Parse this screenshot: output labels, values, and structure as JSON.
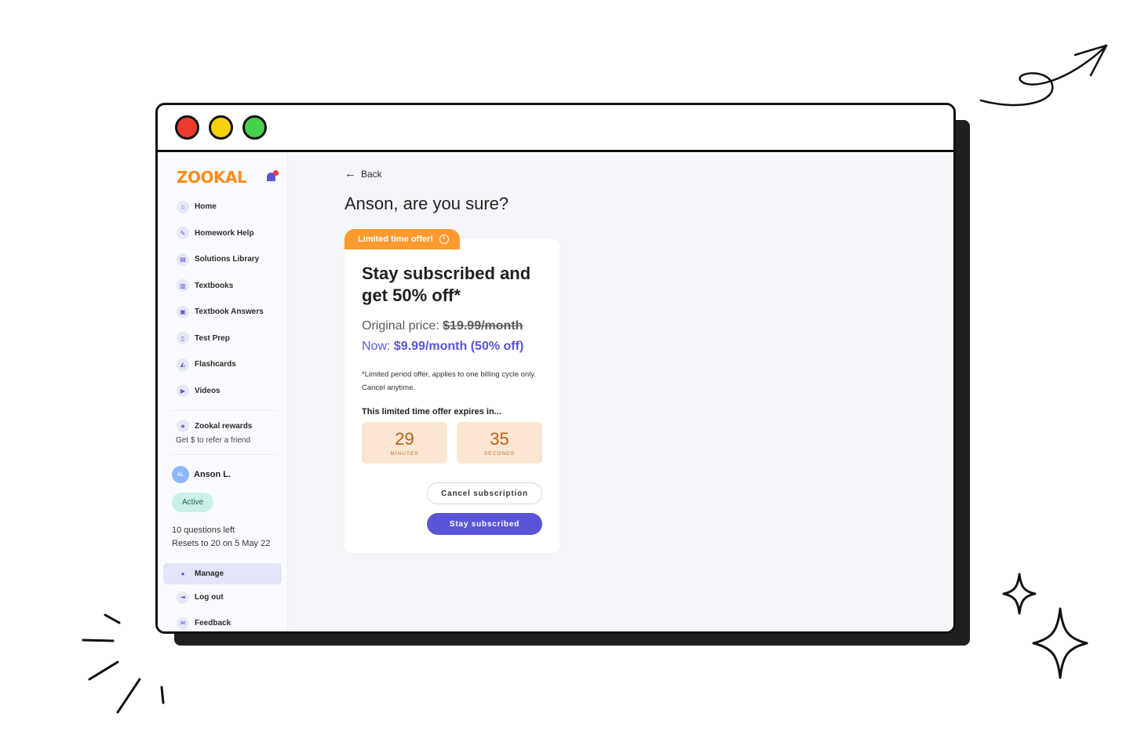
{
  "brand": {
    "logo_text": "ZOOKAL",
    "accent": "#5b55d6",
    "orange": "#ff9a2e"
  },
  "window": {
    "controls": [
      "close",
      "minimize",
      "maximize"
    ]
  },
  "sidebar": {
    "items": [
      {
        "label": "Home",
        "icon": "home-icon"
      },
      {
        "label": "Homework Help",
        "icon": "pencil-icon"
      },
      {
        "label": "Solutions Library",
        "icon": "library-icon"
      },
      {
        "label": "Textbooks",
        "icon": "books-icon"
      },
      {
        "label": "Textbook Answers",
        "icon": "answers-icon"
      },
      {
        "label": "Test Prep",
        "icon": "clipboard-icon"
      },
      {
        "label": "Flashcards",
        "icon": "flashcards-icon"
      },
      {
        "label": "Videos",
        "icon": "video-icon"
      }
    ],
    "rewards": {
      "title": "Zookal rewards",
      "subtitle": "Get $ to refer a friend"
    },
    "user": {
      "initials": "AL",
      "name": "Anson L.",
      "status": "Active",
      "questions_left": "10 questions left",
      "resets": "Resets to 20 on 5 May 22"
    },
    "manage_label": "Manage",
    "logout_label": "Log out",
    "feedback_label": "Feedback"
  },
  "main": {
    "back_label": "Back",
    "heading": "Anson, are you sure?",
    "offer_tab": "Limited time offer!",
    "card": {
      "title": "Stay subscribed and get 50% off*",
      "original_label": "Original price:",
      "original_price": "$19.99/month",
      "now_label": "Now:",
      "now_price": "$9.99/month (50% off)",
      "fine_print": "*Limited period offer, applies to one billing cycle only. Cancel anytime.",
      "expires_label": "This limited time offer expires in...",
      "minutes_value": "29",
      "minutes_label": "MINUTES",
      "seconds_value": "35",
      "seconds_label": "SECONDS",
      "cancel_button": "Cancel subscription",
      "stay_button": "Stay subscribed"
    }
  }
}
